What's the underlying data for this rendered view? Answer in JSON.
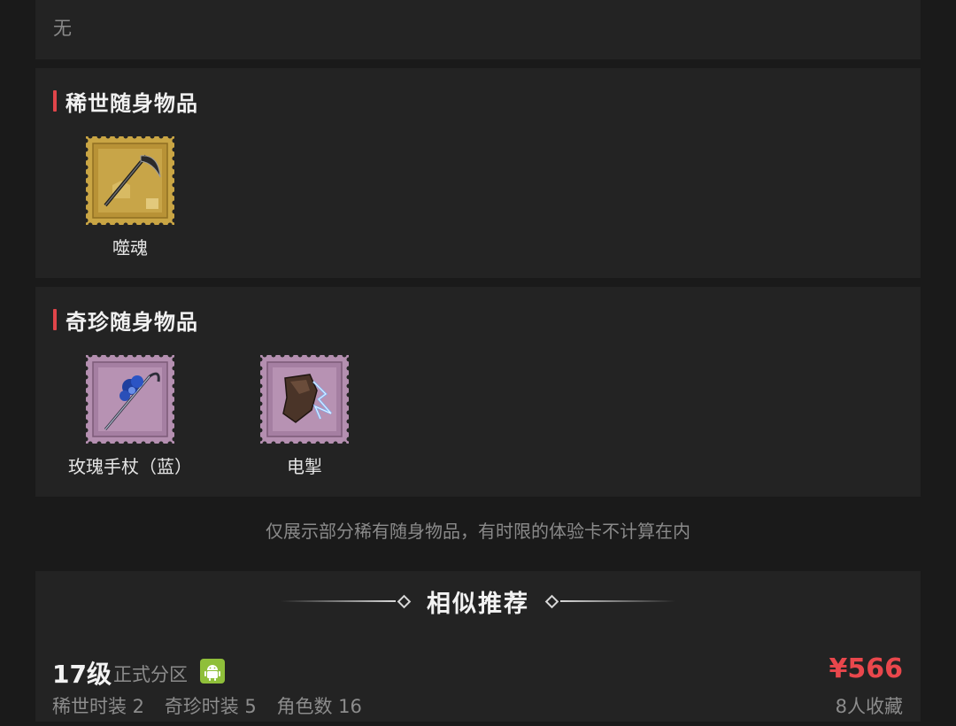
{
  "top_section": {
    "none_text": "无"
  },
  "rare_section": {
    "title": "稀世随身物品",
    "items": [
      {
        "name": "噬魂",
        "icon": "gold-stamp-scythe-icon"
      }
    ]
  },
  "exotic_section": {
    "title": "奇珍随身物品",
    "items": [
      {
        "name": "玫瑰手杖（蓝）",
        "icon": "purple-stamp-rose-cane-icon"
      },
      {
        "name": "电掣",
        "icon": "purple-stamp-lightning-gauntlet-icon"
      }
    ]
  },
  "note": "仅展示部分稀有随身物品，有时限的体验卡不计算在内",
  "recommend": {
    "title": "相似推荐",
    "listing": {
      "level": "17级",
      "zone": "正式分区",
      "platform_icon": "android-icon",
      "price": "¥566",
      "stats": [
        "稀世时装 2",
        "奇珍时装 5",
        "角色数 16"
      ],
      "favorites": "8人收藏"
    }
  },
  "colors": {
    "accent_red": "#e0454a",
    "price_red": "#e9474c",
    "gold_stamp": "#c9a544",
    "purple_stamp": "#b48fb0",
    "android_green": "#8fbf3a"
  }
}
